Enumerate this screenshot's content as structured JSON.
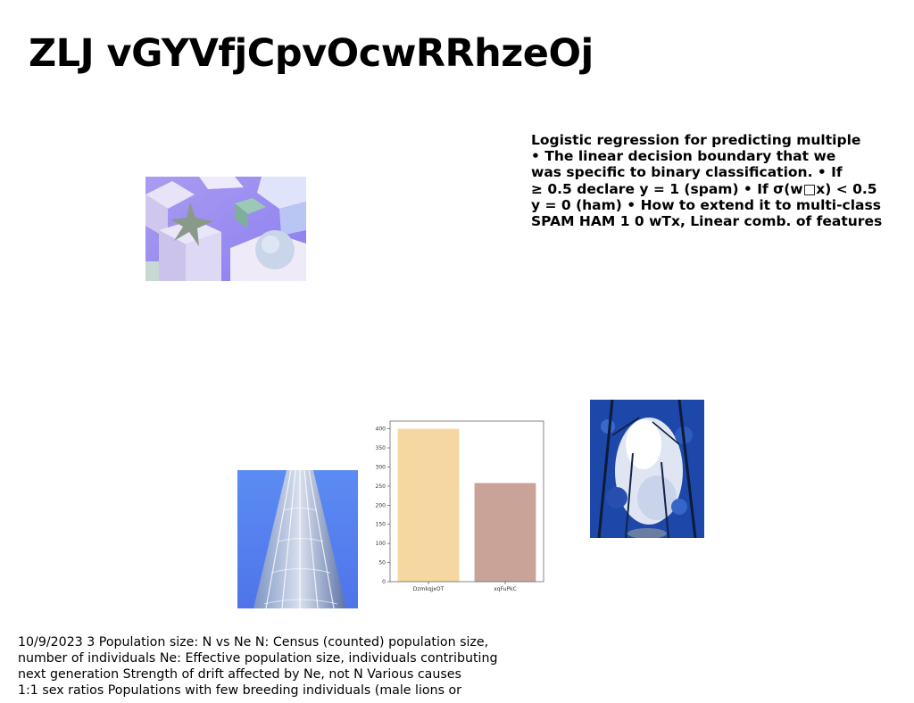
{
  "title": "ZLJ vGYVfjCpvOcwRRhzeOj",
  "side_text": [
    "Logistic regression for predicting multiple",
    "• The linear decision boundary that we",
    "was specific to binary classification. • If",
    "≥ 0.5 declare y = 1 (spam) • If σ(w□x) < 0.5",
    "y = 0 (ham) • How to extend it to multi-class",
    "SPAM HAM 1 0 wTx, Linear comb. of features"
  ],
  "bottom_text": [
    "10/9/2023 3 Population size: N vs Ne  N: Census (counted) population size,",
    "number of individuals  Ne: Effective population size, individuals contributing",
    "next generation  Strength of drift affected by Ne, not N  Various causes ",
    "1:1 sex ratios  Populations with few breeding individuals (male lions or"
  ],
  "images": {
    "gift_boxes": "purple gift boxes with star ornament",
    "skyscraper": "blue skyscraper",
    "tree_sky": "trees against blue sky"
  },
  "chart_data": {
    "type": "bar",
    "categories": [
      "DzmkqjxOT",
      "xqFuPkC"
    ],
    "values": [
      400,
      258
    ],
    "colors": [
      "#f5d8a1",
      "#c9a398"
    ],
    "yticks": [
      0,
      50,
      100,
      150,
      200,
      250,
      300,
      350,
      400
    ],
    "ylim": [
      0,
      420
    ],
    "title": "",
    "xlabel": "",
    "ylabel": "",
    "grid": false
  }
}
